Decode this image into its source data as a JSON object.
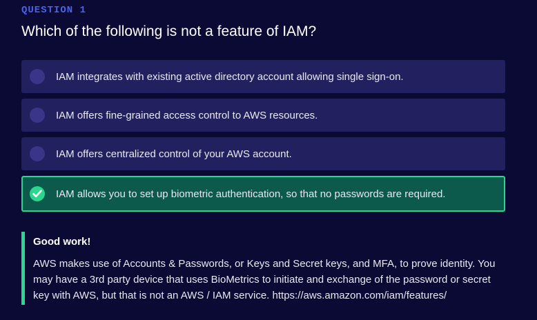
{
  "question": {
    "label": "QUESTION 1",
    "title": "Which of the following is not a feature of IAM?"
  },
  "answers": [
    {
      "text": "IAM integrates with existing active directory account allowing single sign-on.",
      "selected": false
    },
    {
      "text": "IAM offers fine-grained access control to AWS resources.",
      "selected": false
    },
    {
      "text": "IAM offers centralized control of your AWS account.",
      "selected": false
    },
    {
      "text": "IAM allows you to set up biometric authentication, so that no passwords are required.",
      "selected": true
    }
  ],
  "feedback": {
    "title": "Good work!",
    "body": "AWS makes use of Accounts & Passwords, or Keys and Secret keys, and MFA, to prove identity. You may have a 3rd party device that uses BioMetrics to initiate and exchange of the password or secret key with AWS, but that is not an AWS / IAM service. https://aws.amazon.com/iam/features/"
  },
  "colors": {
    "background": "#0b0a35",
    "accent": "#4b63e8",
    "answer_bg": "#232060",
    "success": "#2bd78c",
    "success_bg": "#0c5a4c"
  },
  "icons": {
    "radio": "radio-unchecked-icon",
    "check": "check-circle-icon"
  }
}
